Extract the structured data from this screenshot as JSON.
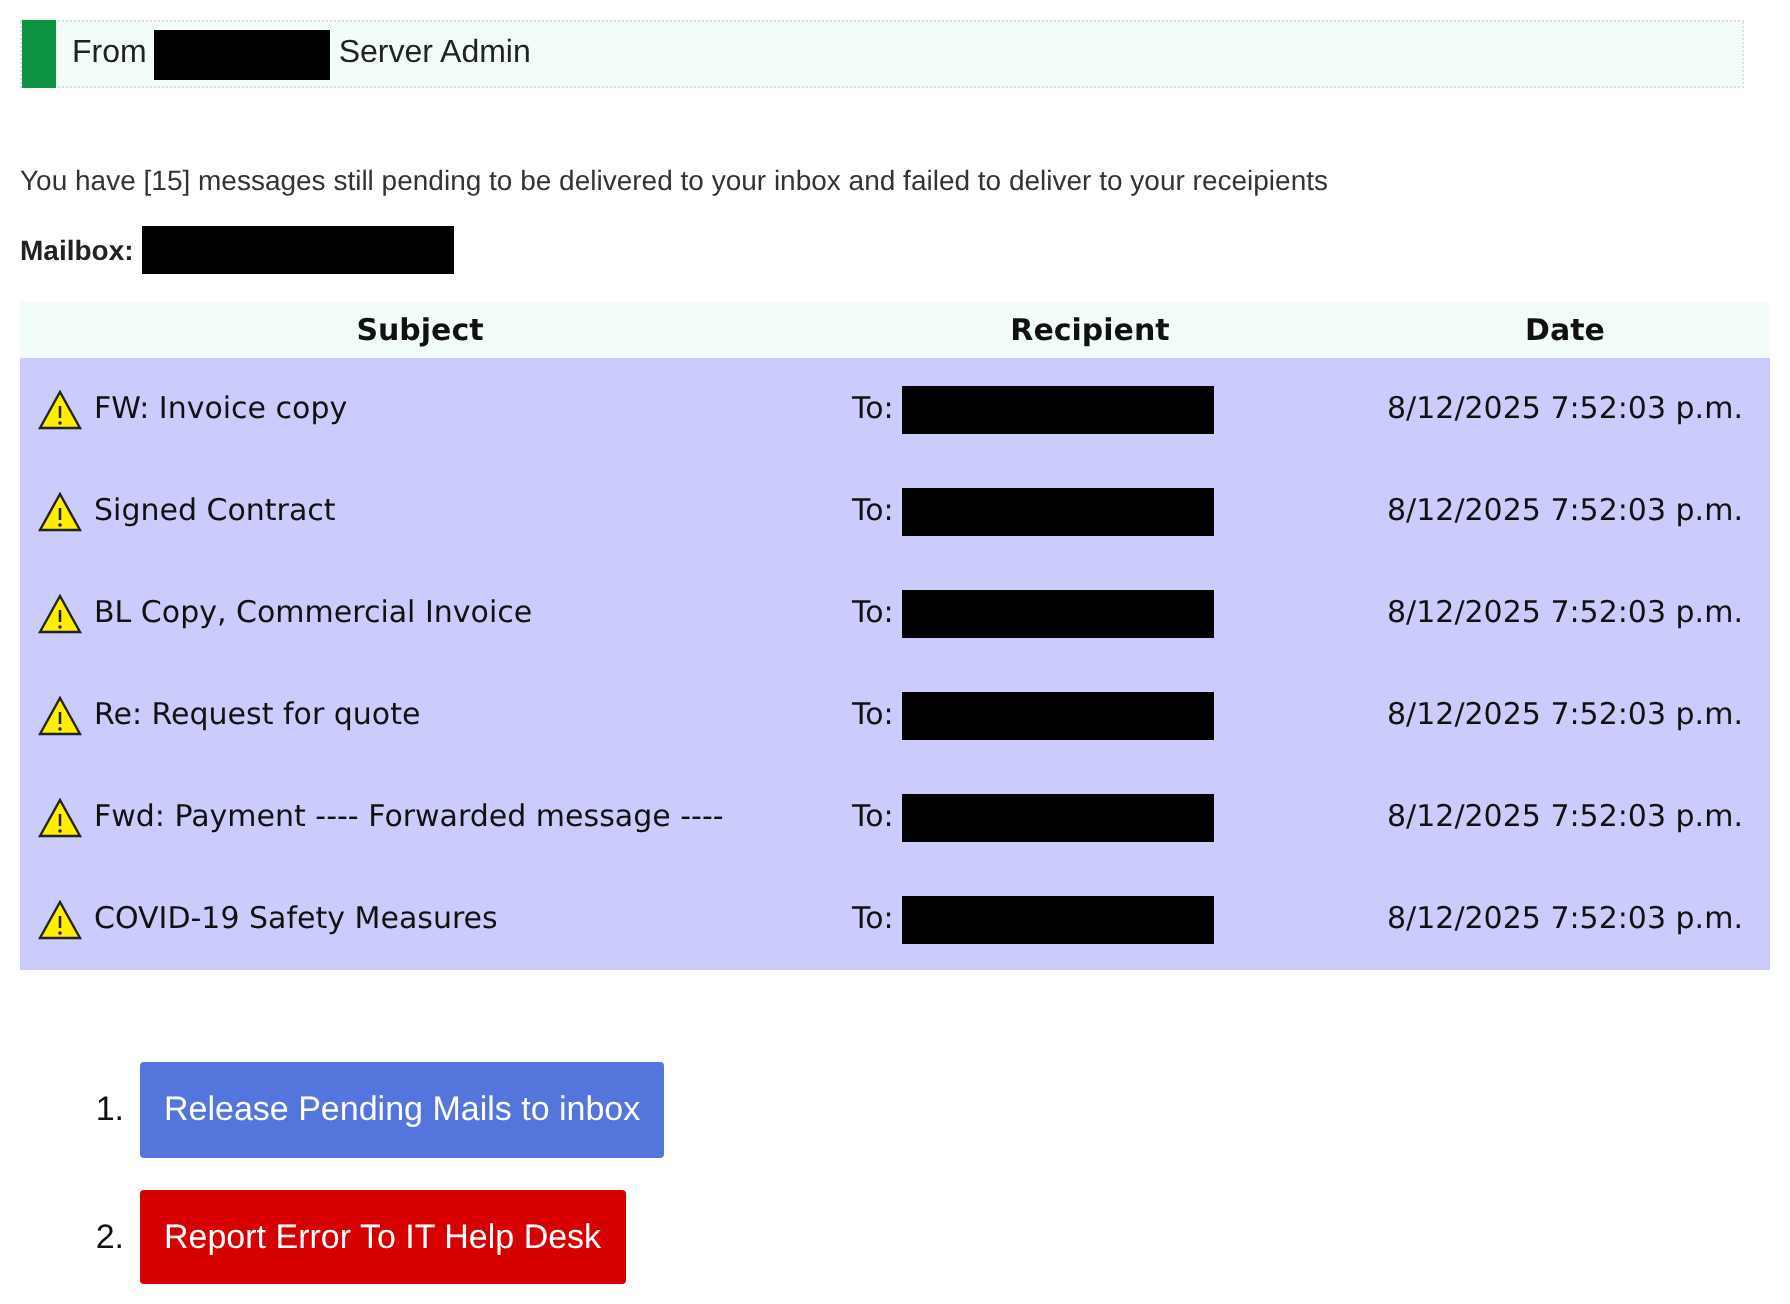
{
  "sender_bar": {
    "prefix": "From",
    "suffix": "Server Admin"
  },
  "notice": "You have [15] messages still pending to be delivered to your inbox and failed to deliver to your receipients",
  "mailbox": {
    "label": "Mailbox:"
  },
  "table": {
    "columns": [
      "Subject",
      "Recipient",
      "Date"
    ],
    "rows": [
      {
        "subject": "FW: Invoice copy",
        "recipient_prefix": "To:",
        "date": "8/12/2025 7:52:03 p.m."
      },
      {
        "subject": "Signed Contract",
        "recipient_prefix": "To:",
        "date": "8/12/2025 7:52:03 p.m."
      },
      {
        "subject": "BL Copy, Commercial Invoice",
        "recipient_prefix": "To:",
        "date": "8/12/2025 7:52:03 p.m."
      },
      {
        "subject": "Re: Request for quote",
        "recipient_prefix": "To:",
        "date": "8/12/2025 7:52:03 p.m."
      },
      {
        "subject": "Fwd: Payment ---- Forwarded message ----",
        "recipient_prefix": "To:",
        "date": "8/12/2025 7:52:03 p.m."
      },
      {
        "subject": "COVID-19 Safety Measures",
        "recipient_prefix": "To:",
        "date": "8/12/2025 7:52:03 p.m."
      }
    ]
  },
  "actions": [
    {
      "number": "1.",
      "label": "Release Pending Mails to inbox",
      "kind": "primary"
    },
    {
      "number": "2.",
      "label": "Report Error To IT Help Desk",
      "kind": "danger"
    }
  ]
}
